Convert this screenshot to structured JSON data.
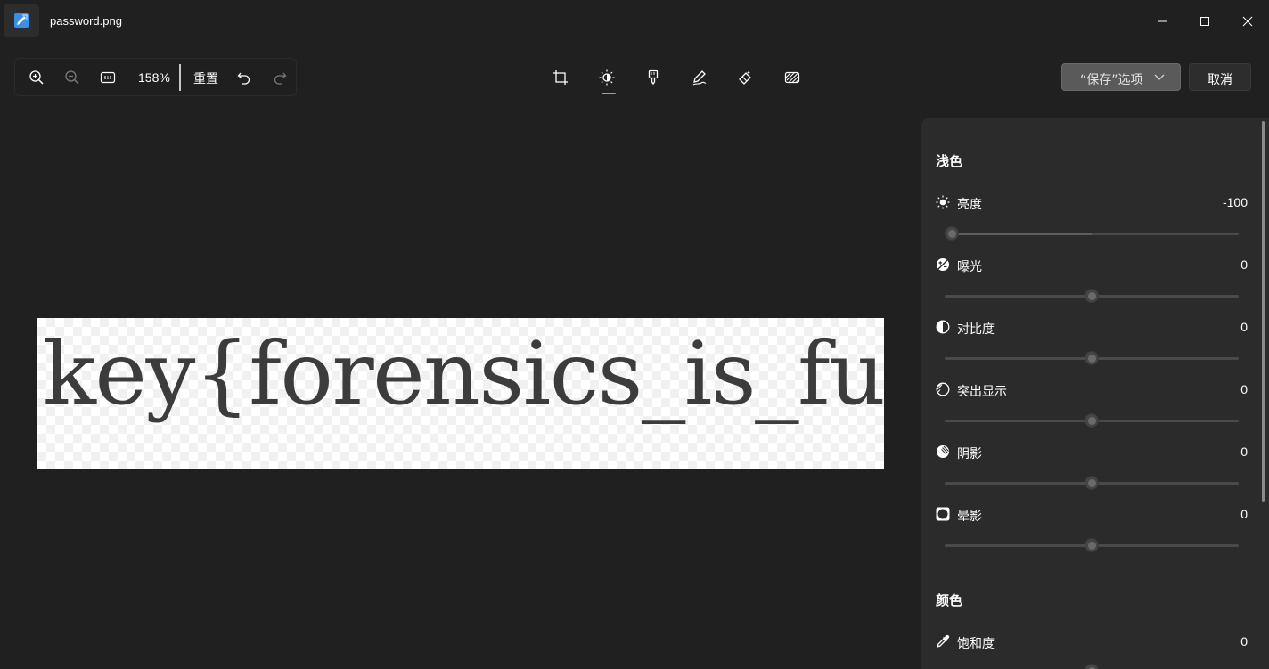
{
  "window": {
    "title": "password.png",
    "icon": "photos-edit-icon"
  },
  "toolbar": {
    "zoom_in_icon": "zoom-in-icon",
    "zoom_out_icon": "zoom-out-icon",
    "actual_size_icon": "actual-size-icon",
    "zoom_level": "158%",
    "reset_label": "重置",
    "undo_icon": "undo-icon",
    "redo_icon": "redo-icon"
  },
  "tools": [
    "crop-icon",
    "adjust-icon",
    "filter-icon",
    "markup-icon",
    "erase-icon",
    "background-icon"
  ],
  "actions": {
    "save_label": "“保存”选项",
    "cancel_label": "取消"
  },
  "image": {
    "content_text": "key{forensics_is_fun}"
  },
  "panel": {
    "light_title": "浅色",
    "color_title": "颜色",
    "light": [
      {
        "label": "亮度",
        "value": "-100",
        "level": -100,
        "icon": "brightness-icon"
      },
      {
        "label": "曝光",
        "value": "0",
        "level": 0,
        "icon": "exposure-icon"
      },
      {
        "label": "对比度",
        "value": "0",
        "level": 0,
        "icon": "contrast-icon"
      },
      {
        "label": "突出显示",
        "value": "0",
        "level": 0,
        "icon": "highlights-icon"
      },
      {
        "label": "阴影",
        "value": "0",
        "level": 0,
        "icon": "shadows-icon"
      },
      {
        "label": "晕影",
        "value": "0",
        "level": 0,
        "icon": "vignette-icon"
      }
    ],
    "color": [
      {
        "label": "饱和度",
        "value": "0",
        "level": 0,
        "icon": "saturation-icon"
      }
    ]
  },
  "colors": {
    "background": "#202020",
    "panel": "#2b2b2b",
    "accent_blue": "#3a8ee6"
  }
}
